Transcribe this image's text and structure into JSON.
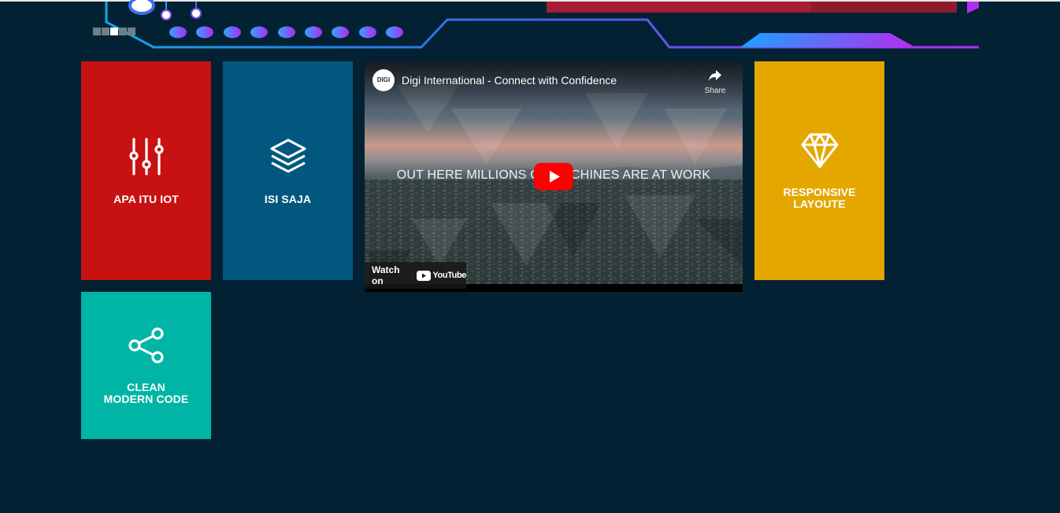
{
  "slider": {
    "dots": 5,
    "active_index": 2
  },
  "tiles": [
    {
      "label": "APA ITU IOT",
      "icon": "sliders-icon",
      "color": "#c81212"
    },
    {
      "label": "ISI SAJA",
      "icon": "layers-icon",
      "color": "#02577f"
    },
    {
      "label": "RESPONSIVE\nLAYOUTE",
      "icon": "diamond-icon",
      "color": "#e3a700"
    },
    {
      "label": "CLEAN\nMODERN CODE",
      "icon": "share-icon",
      "color": "#00b5a6"
    }
  ],
  "video": {
    "channel_logo_text": "DIGI",
    "title": "Digi International - Connect with Confidence",
    "share_label": "Share",
    "caption": "OUT HERE MILLIONS OF MACHINES ARE AT WORK",
    "watch_on_label": "Watch on",
    "youtube_label": "YouTube",
    "play_color": "#ff0000"
  }
}
